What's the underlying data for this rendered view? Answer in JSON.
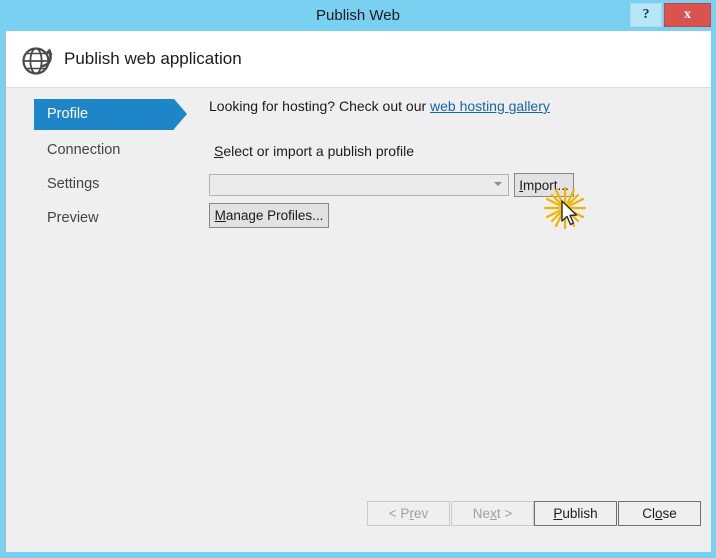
{
  "window": {
    "title": "Publish Web",
    "titlebar_buttons": [
      {
        "name": "help",
        "glyph": "?"
      },
      {
        "name": "close",
        "glyph": "x"
      }
    ],
    "colors": {
      "titlebar": "#7ad0f0",
      "accent": "#1e86c8",
      "close_button": "#d9534f",
      "body": "#efefef",
      "link": "#1763b0",
      "burst": "#f5c518"
    }
  },
  "header": {
    "icon": "globe-publish-icon",
    "title": "Publish web application"
  },
  "sidebar": {
    "items": [
      {
        "label": "Profile",
        "selected": true
      },
      {
        "label": "Connection",
        "selected": false
      },
      {
        "label": "Settings",
        "selected": false
      },
      {
        "label": "Preview",
        "selected": false
      }
    ]
  },
  "main": {
    "hosting_prompt": "Looking for hosting? Check out our ",
    "hosting_link": "web hosting gallery",
    "profile_label_accel": "S",
    "profile_label_rest": "elect or import a publish profile",
    "profile_combo": {
      "value": "",
      "placeholder": "",
      "enabled": true,
      "arrow": "chevron-down-icon"
    },
    "import_button": {
      "accel": "I",
      "rest": "mport..."
    },
    "manage_profiles_button": {
      "accel": "M",
      "rest": "anage Profiles..."
    }
  },
  "footer": {
    "buttons": [
      {
        "pre": "< P",
        "accel": "r",
        "post": "ev",
        "name": "prev",
        "disabled": true
      },
      {
        "pre": "Ne",
        "accel": "x",
        "post": "t >",
        "name": "next",
        "disabled": true
      },
      {
        "pre": "",
        "accel": "P",
        "post": "ublish",
        "name": "publish",
        "disabled": false
      },
      {
        "pre": "Cl",
        "accel": "o",
        "post": "se",
        "name": "close",
        "disabled": false
      }
    ]
  },
  "pointer": {
    "cursor": "arrow-cursor",
    "click_effect": "click-burst-star"
  }
}
